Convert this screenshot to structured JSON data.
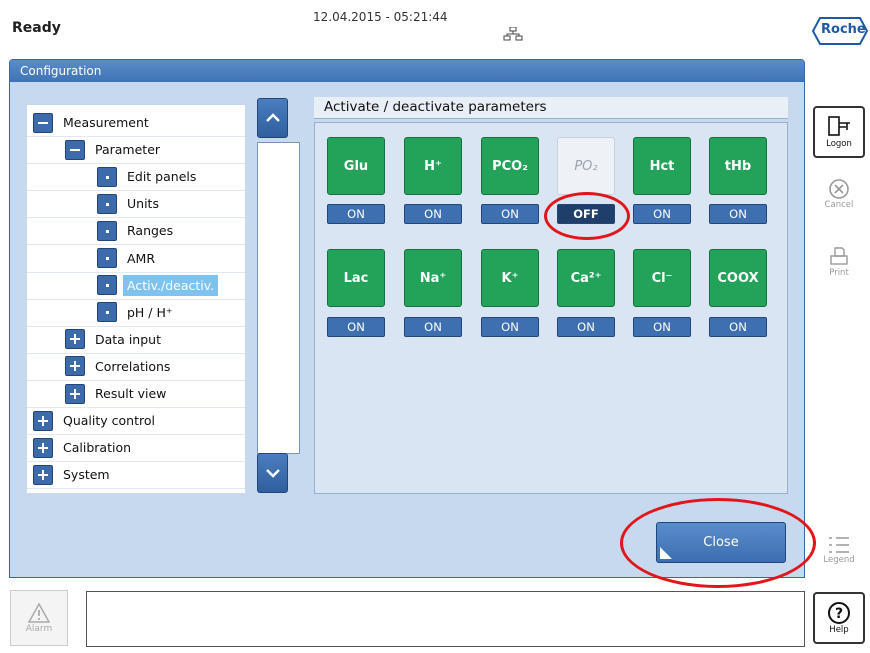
{
  "header": {
    "status": "Ready",
    "datetime": "12.04.2015 - 05:21:44",
    "logo": "Roche"
  },
  "window": {
    "title": "Configuration"
  },
  "tree": {
    "items": [
      {
        "label": "Measurement",
        "icon": "minus"
      },
      {
        "label": "Parameter",
        "icon": "minus"
      },
      {
        "label": "Edit panels",
        "icon": "dot"
      },
      {
        "label": "Units",
        "icon": "dot"
      },
      {
        "label": "Ranges",
        "icon": "dot"
      },
      {
        "label": "AMR",
        "icon": "dot"
      },
      {
        "label": "Activ./deactiv.",
        "icon": "dot",
        "selected": true
      },
      {
        "label": "pH / H⁺",
        "icon": "dot"
      },
      {
        "label": "Data input",
        "icon": "plus"
      },
      {
        "label": "Correlations",
        "icon": "plus"
      },
      {
        "label": "Result view",
        "icon": "plus"
      },
      {
        "label": "Quality control",
        "icon": "plus"
      },
      {
        "label": "Calibration",
        "icon": "plus"
      },
      {
        "label": "System",
        "icon": "plus"
      }
    ]
  },
  "panel": {
    "heading": "Activate / deactivate parameters",
    "parameters": [
      {
        "name": "Glu",
        "state": "ON"
      },
      {
        "name": "H⁺",
        "state": "ON"
      },
      {
        "name": "PCO₂",
        "state": "ON"
      },
      {
        "name": "PO₂",
        "state": "OFF"
      },
      {
        "name": "Hct",
        "state": "ON"
      },
      {
        "name": "tHb",
        "state": "ON"
      },
      {
        "name": "Lac",
        "state": "ON"
      },
      {
        "name": "Na⁺",
        "state": "ON"
      },
      {
        "name": "K⁺",
        "state": "ON"
      },
      {
        "name": "Ca²⁺",
        "state": "ON"
      },
      {
        "name": "Cl⁻",
        "state": "ON"
      },
      {
        "name": "COOX",
        "state": "ON"
      }
    ]
  },
  "buttons": {
    "close": "Close"
  },
  "sidebar": {
    "logon": "Logon",
    "cancel": "Cancel",
    "print": "Print",
    "legend": "Legend",
    "help": "Help"
  },
  "footer": {
    "alarm": "Alarm"
  },
  "colors": {
    "tile_on": "#23a35a",
    "toggle": "#3e6fb0",
    "highlight": "#e2151a",
    "window": "#c7d9ee"
  }
}
